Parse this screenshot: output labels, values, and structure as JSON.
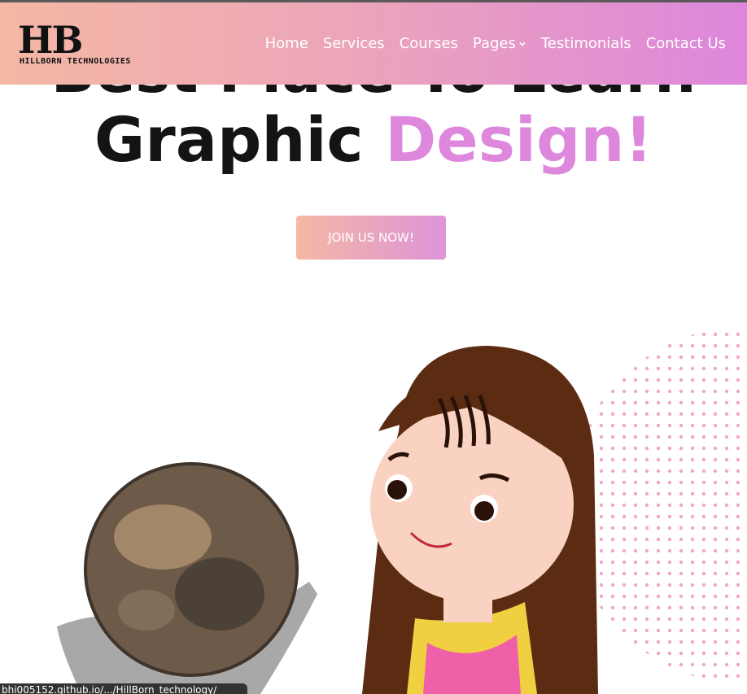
{
  "brand": {
    "mark": "HB",
    "name": "HILLBORN TECHNOLOGIES"
  },
  "nav": {
    "items": [
      {
        "label": "Home"
      },
      {
        "label": "Services"
      },
      {
        "label": "Courses"
      },
      {
        "label": "Pages",
        "dropdown": true
      },
      {
        "label": "Testimonials"
      },
      {
        "label": "Contact Us"
      }
    ]
  },
  "hero": {
    "line1": "Best Place To Learn",
    "line2_main": "Graphic",
    "line2_accent": "Design!",
    "cta_label": "JOIN US NOW!"
  },
  "status": {
    "url": "bhi005152.github.io/.../HillBorn_technology/"
  },
  "colors": {
    "accent": "#dd88dd",
    "gradient_start": "#f4b8a4",
    "gradient_end": "#dd86dc",
    "text": "#141414"
  }
}
